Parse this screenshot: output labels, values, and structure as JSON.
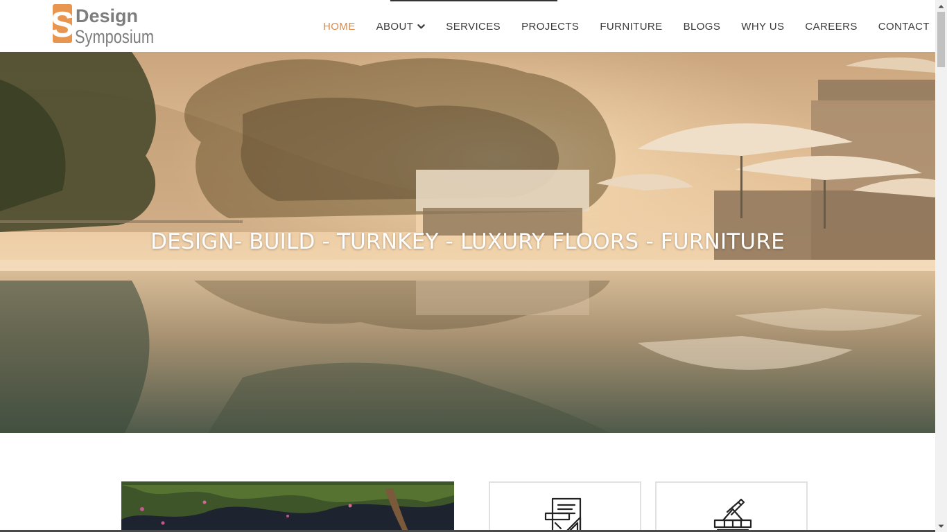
{
  "brand": {
    "logo_line1": "Design",
    "logo_line2": "Symposium",
    "logo_letter": "S",
    "accent_color": "#e8964f",
    "logo_gray": "#7d7d7d"
  },
  "nav": {
    "items": [
      {
        "label": "HOME",
        "active": true
      },
      {
        "label": "ABOUT",
        "has_dropdown": true
      },
      {
        "label": "SERVICES"
      },
      {
        "label": "PROJECTS"
      },
      {
        "label": "FURNITURE"
      },
      {
        "label": "BLOGS"
      },
      {
        "label": "WHY US"
      },
      {
        "label": "CAREERS"
      },
      {
        "label": "CONTACT"
      }
    ],
    "active_color": "#d9894a",
    "text_color": "#3a3a3a",
    "dropdown_icon": "chevron-down-icon"
  },
  "hero": {
    "title": "DESIGN- BUILD - TURNKEY - LUXURY FLOORS - FURNITURE",
    "image_subject": "infinity-pool-with-umbrellas-at-sunset"
  },
  "services": {
    "cards": [
      {
        "icon": "blueprint-drafting-icon"
      },
      {
        "icon": "construction-build-icon"
      }
    ]
  }
}
